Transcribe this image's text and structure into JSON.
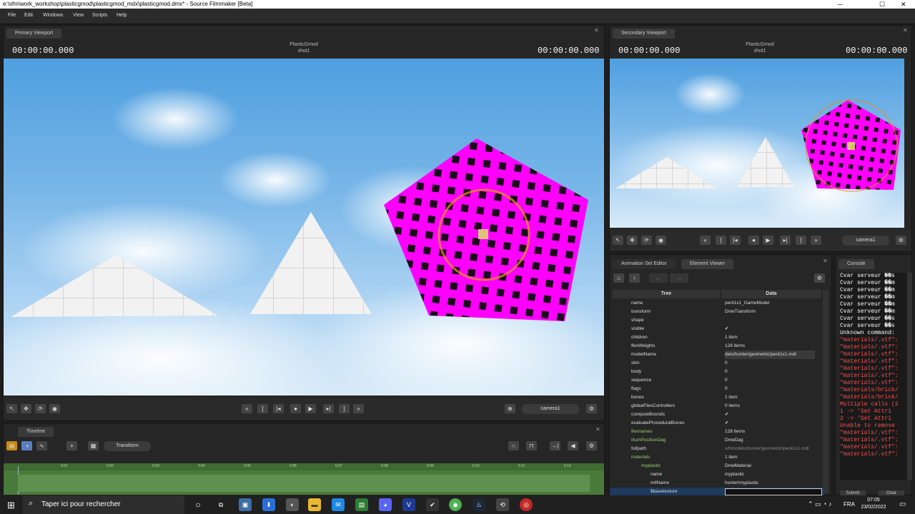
{
  "window": {
    "title": "e:\\sfm\\work_workshop\\plasticgmod\\plasticgmod_mdx\\plasticgmod.dmx* - Source Filmmaker [Beta]",
    "minimize": "─",
    "maximize": "☐",
    "close": "✕"
  },
  "menu": [
    "File",
    "Edit",
    "Windows",
    "View",
    "Scripts",
    "Help"
  ],
  "primary_viewport": {
    "tab": "Primary Viewport",
    "timecode_left": "00:00:00.000",
    "timecode_right": "00:00:00.000",
    "session": "PlasticGmod",
    "shot": "shot1",
    "camera": "camera1"
  },
  "secondary_viewport": {
    "tab": "Secondary Viewport",
    "timecode_left": "00:00:00.000",
    "timecode_right": "00:00:00.000",
    "session": "PlasticGmod",
    "shot": "shot1",
    "camera": "camera1"
  },
  "timeline": {
    "tab": "Timeline",
    "mode": "Transform",
    "ticks": [
      "0.01",
      "0.02",
      "0.03",
      "0.04",
      "0.05",
      "0.06",
      "0.07",
      "0.08",
      "0.09",
      "0.10",
      "0.11",
      "0.12"
    ]
  },
  "element_viewer": {
    "tabs": [
      "Animation Set Editor",
      "Element Viewer"
    ],
    "col_tree": "Tree",
    "col_data": "Data",
    "rows": [
      {
        "key": "name",
        "value": "pent1x1_GameModel"
      },
      {
        "key": "transform",
        "value": "DmeTransform"
      },
      {
        "key": "shape",
        "value": ""
      },
      {
        "key": "visible",
        "value": "✔"
      },
      {
        "key": "children",
        "value": "1 item"
      },
      {
        "key": "flexWeights",
        "value": "128 items"
      },
      {
        "key": "modelName",
        "value": "dels/hunter/geometric/pent1x1.mdl"
      },
      {
        "key": "skin",
        "value": "0"
      },
      {
        "key": "body",
        "value": "0"
      },
      {
        "key": "sequence",
        "value": "0"
      },
      {
        "key": "flags",
        "value": "0"
      },
      {
        "key": "bones",
        "value": "1 item"
      },
      {
        "key": "globalFlexControllers",
        "value": "0 items"
      },
      {
        "key": "computeBounds",
        "value": "✔"
      },
      {
        "key": "evaluateProceduralBones",
        "value": "✔"
      },
      {
        "key": "flexnames",
        "value": "128 items"
      },
      {
        "key": "illumPositionDag",
        "value": "DmeDag"
      },
      {
        "key": "fullpath",
        "value": "s/t\\models\\hunter\\geometric\\pent1x1.mdl"
      },
      {
        "key": "materials",
        "value": "1 item"
      },
      {
        "key": "myplastic",
        "value": "DmeMaterial"
      },
      {
        "key": "name",
        "value": "myplastic"
      },
      {
        "key": "mtlName",
        "value": "hunter\\myplastic"
      },
      {
        "key": "$basetexture",
        "value": ""
      }
    ]
  },
  "console": {
    "tab": "Console",
    "lines": [
      {
        "text": "Cvar serveur ��s",
        "color": "#ffffff"
      },
      {
        "text": "Cvar serveur ��m",
        "color": "#ffffff"
      },
      {
        "text": "Cvar serveur ��m",
        "color": "#ffffff"
      },
      {
        "text": "Cvar serveur ��m",
        "color": "#ffffff"
      },
      {
        "text": "Cvar serveur ��m",
        "color": "#ffffff"
      },
      {
        "text": "Cvar serveur ��m",
        "color": "#ffffff"
      },
      {
        "text": "Cvar serveur ��s",
        "color": "#ffffff"
      },
      {
        "text": "Cvar serveur ��s",
        "color": "#ffffff"
      },
      {
        "text": "Unknown command:",
        "color": "#ffffff"
      },
      {
        "text": "\"materials/.vtf\":",
        "color": "#ff4d4d"
      },
      {
        "text": "\"materials/.vtf\":",
        "color": "#ff4d4d"
      },
      {
        "text": "\"materials/.vtf\":",
        "color": "#ff4d4d"
      },
      {
        "text": "\"materials/.vtf\":",
        "color": "#ff4d4d"
      },
      {
        "text": "\"materials/.vtf\":",
        "color": "#ff4d4d"
      },
      {
        "text": "\"materials/.vtf\":",
        "color": "#ff4d4d"
      },
      {
        "text": "\"materials/.vtf\":",
        "color": "#ff4d4d"
      },
      {
        "text": "\"materials/brick/",
        "color": "#ff4d4d"
      },
      {
        "text": "\"materials/brick/",
        "color": "#ff4d4d"
      },
      {
        "text": "Multiple calls (2",
        "color": "#ff4d4d"
      },
      {
        "text": "  1 -> 'Set Attri",
        "color": "#ff4d4d"
      },
      {
        "text": "  2 -> 'Set Attri",
        "color": "#ff4d4d"
      },
      {
        "text": "Unable to remove",
        "color": "#ff4d4d"
      },
      {
        "text": "\"materials/.vtf\":",
        "color": "#ff4d4d"
      },
      {
        "text": "\"materials/.vtf\":",
        "color": "#ff4d4d"
      },
      {
        "text": "\"materials/.vtf\":",
        "color": "#ff4d4d"
      },
      {
        "text": "\"materials/.vtf\":",
        "color": "#ff4d4d"
      }
    ],
    "submit": "Submit",
    "clear": "Clear"
  },
  "taskbar": {
    "search_placeholder": "Taper ici pour rechercher",
    "language": "FRA",
    "time": "07:05",
    "date": "23/02/2022"
  },
  "colors": {
    "magenta": "#ff00ff",
    "timeline_green": "#4a7a3a",
    "accent_orange": "#e89020"
  }
}
